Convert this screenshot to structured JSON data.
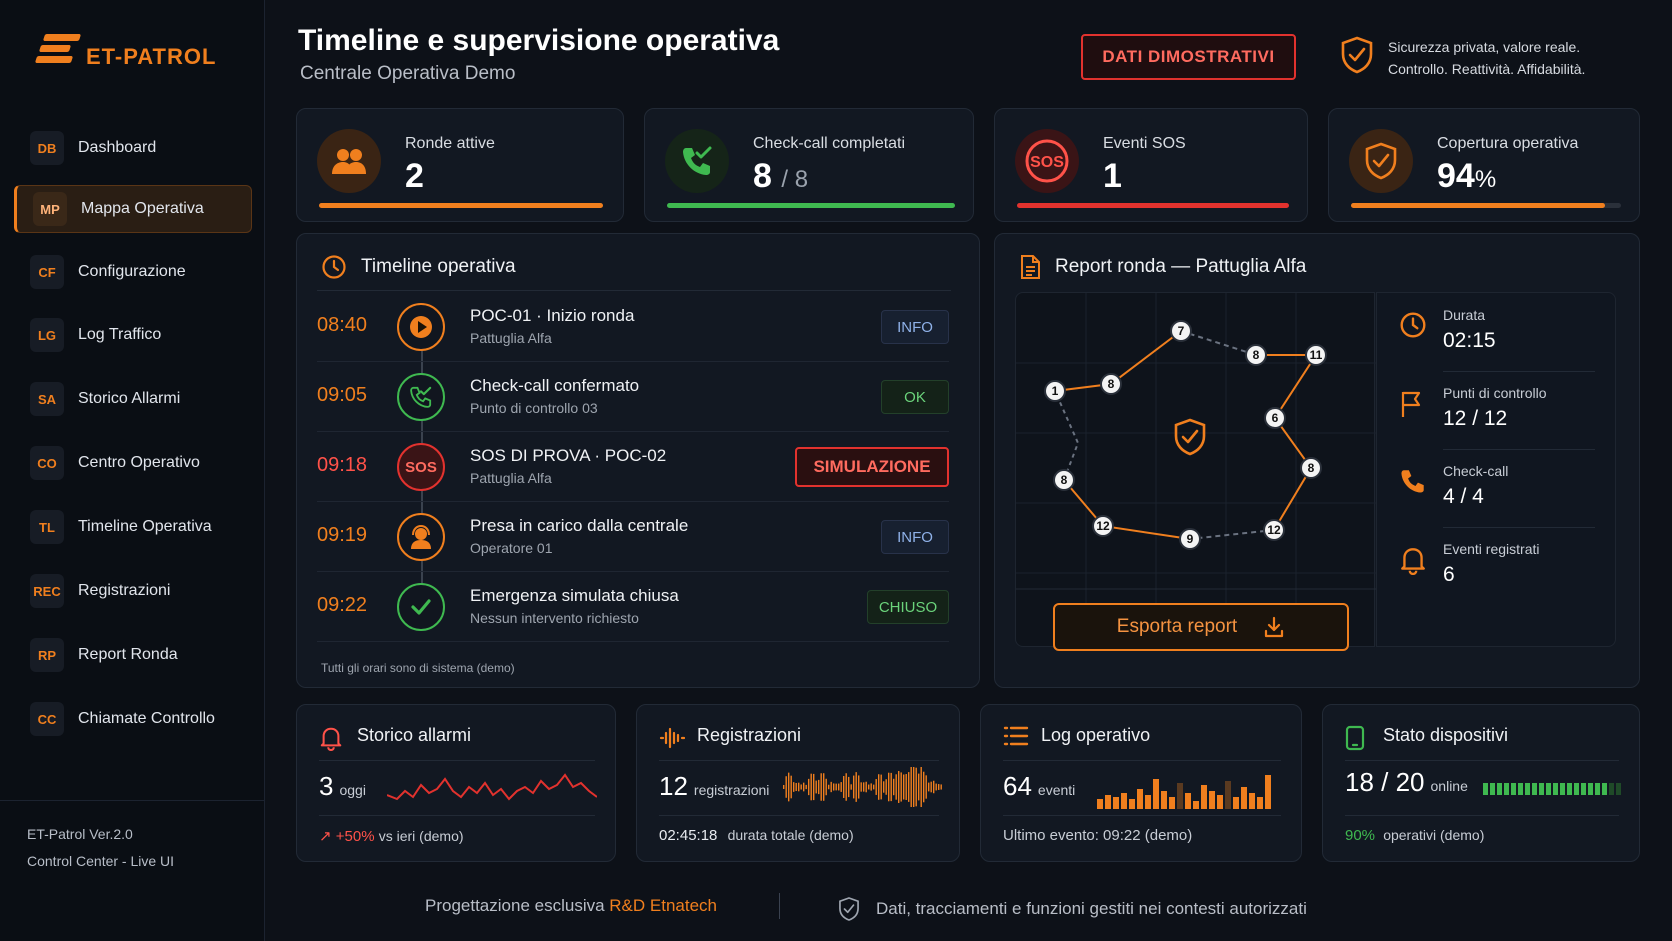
{
  "brand": {
    "name": "ET-PATROL",
    "accent": "#f07f1e"
  },
  "sidebar": {
    "items": [
      {
        "code": "DB",
        "label": "Dashboard",
        "active": false
      },
      {
        "code": "MP",
        "label": "Mappa Operativa",
        "active": true
      },
      {
        "code": "CF",
        "label": "Configurazione",
        "active": false
      },
      {
        "code": "LG",
        "label": "Log Traffico",
        "active": false
      },
      {
        "code": "SA",
        "label": "Storico Allarmi",
        "active": false
      },
      {
        "code": "CO",
        "label": "Centro Operativo",
        "active": false
      },
      {
        "code": "TL",
        "label": "Timeline Operativa",
        "active": false
      },
      {
        "code": "REC",
        "label": "Registrazioni",
        "active": false
      },
      {
        "code": "RP",
        "label": "Report Ronda",
        "active": false
      },
      {
        "code": "CC",
        "label": "Chiamate Controllo",
        "active": false
      }
    ],
    "version": "ET-Patrol Ver.2.0",
    "subtitle": "Control Center - Live UI"
  },
  "header": {
    "title": "Timeline e supervisione operativa",
    "subtitle": "Centrale Operativa Demo",
    "demo_label": "DATI DIMOSTRATIVI",
    "tagline_1": "Sicurezza privata, valore reale.",
    "tagline_2": "Controllo. Reattività. Affidabilità."
  },
  "stats": {
    "ronde": {
      "label": "Ronde attive",
      "value": "2",
      "fill": 1.0,
      "color": "#f07f1e"
    },
    "checkcall": {
      "label": "Check-call completati",
      "value": "8",
      "total": "/ 8",
      "fill": 1.0,
      "color": "#3fb950"
    },
    "sos": {
      "label": "Eventi SOS",
      "value": "1",
      "fill": 1.0,
      "color": "#e2322e",
      "icon_text": "SOS"
    },
    "copertura": {
      "label": "Copertura operativa",
      "value": "94",
      "unit": "%",
      "fill": 0.94,
      "color": "#f07f1e"
    }
  },
  "timeline": {
    "title": "Timeline operativa",
    "note": "Tutti gli orari sono di sistema (demo)",
    "rows": [
      {
        "time": "08:40",
        "title": "POC-01 · Inizio ronda",
        "sub": "Pattuglia Alfa",
        "tag": "INFO",
        "icon": "play-icon"
      },
      {
        "time": "09:05",
        "title": "Check-call confermato",
        "sub": "Punto di controllo 03",
        "tag": "OK",
        "icon": "phone-check-icon"
      },
      {
        "time": "09:18",
        "title": "SOS DI PROVA  ·  POC-02",
        "sub": "Pattuglia Alfa",
        "tag": "SIMULAZIONE",
        "icon": "sos-icon",
        "icon_text": "SOS"
      },
      {
        "time": "09:19",
        "title": "Presa in carico dalla centrale",
        "sub": "Operatore 01",
        "tag": "INFO",
        "icon": "operator-icon"
      },
      {
        "time": "09:22",
        "title": "Emergenza simulata chiusa",
        "sub": "Nessun intervento richiesto",
        "tag": "CHIUSO",
        "icon": "check-icon"
      }
    ]
  },
  "report": {
    "title": "Report ronda — Pattuglia Alfa",
    "map_points": [
      "1",
      "8",
      "7",
      "8",
      "11",
      "6",
      "8",
      "12",
      "9",
      "12",
      "8"
    ],
    "durata_label": "Durata",
    "durata_value": "02:15",
    "punti_label": "Punti di controllo",
    "punti_value": "12 / 12",
    "check_label": "Check-call",
    "check_value": "4 / 4",
    "eventi_label": "Eventi registrati",
    "eventi_value": "6",
    "export_label": "Esporta report"
  },
  "bottom": {
    "allarmi": {
      "title": "Storico allarmi",
      "value": "3",
      "unit": "oggi",
      "delta": "+50%",
      "delta_note": "vs ieri (demo)"
    },
    "registrazioni": {
      "title": "Registrazioni",
      "value": "12",
      "unit": "registrazioni",
      "duration": "02:45:18",
      "duration_note": "durata totale (demo)"
    },
    "log": {
      "title": "Log operativo",
      "value": "64",
      "unit": "eventi",
      "last": "Ultimo evento: 09:22 (demo)"
    },
    "dispositivi": {
      "title": "Stato dispositivi",
      "value": "18 / 20",
      "unit": "online",
      "pct": "90%",
      "pct_note": "operativi (demo)",
      "online": 18,
      "total": 20
    }
  },
  "footer": {
    "left_prefix": "Progettazione esclusiva",
    "left_brand": "R&D Etnatech",
    "right": "Dati, tracciamenti e funzioni gestiti nei contesti autorizzati"
  }
}
